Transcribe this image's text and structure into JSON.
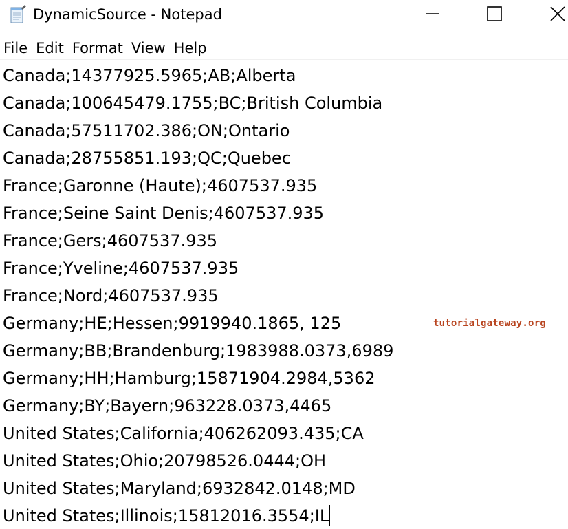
{
  "window": {
    "title": "DynamicSource - Notepad",
    "icon": "notepad-icon",
    "controls": {
      "minimize_icon": "minimize-icon",
      "maximize_icon": "maximize-icon",
      "close_icon": "close-icon"
    }
  },
  "menu": {
    "items": [
      "File",
      "Edit",
      "Format",
      "View",
      "Help"
    ]
  },
  "editor": {
    "lines": [
      "Canada;14377925.5965;AB;Alberta",
      "Canada;100645479.1755;BC;British Columbia",
      "Canada;57511702.386;ON;Ontario",
      "Canada;28755851.193;QC;Quebec",
      "France;Garonne (Haute);4607537.935",
      "France;Seine Saint Denis;4607537.935",
      "France;Gers;4607537.935",
      "France;Yveline;4607537.935",
      "France;Nord;4607537.935",
      "Germany;HE;Hessen;9919940.1865, 125",
      "Germany;BB;Brandenburg;1983988.0373,6989",
      "Germany;HH;Hamburg;15871904.2984,5362",
      "Germany;BY;Bayern;963228.0373,4465",
      "United States;California;406262093.435;CA",
      "United States;Ohio;20798526.0444;OH",
      "United States;Maryland;6932842.0148;MD",
      "United States;Illinois;15812016.3554;IL"
    ],
    "caret_line": 17
  },
  "watermark": {
    "text": "tutorialgateway.org",
    "color": "#b8441f"
  }
}
